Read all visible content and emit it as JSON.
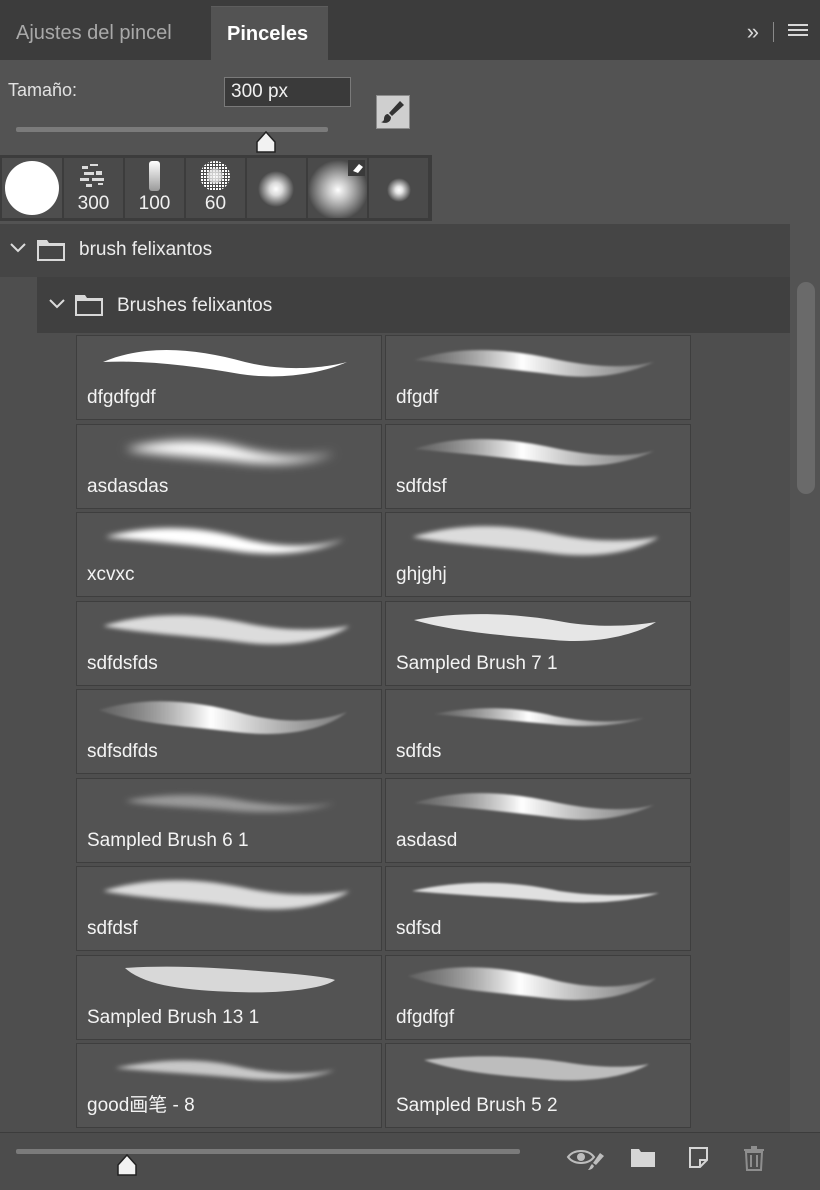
{
  "tabs": [
    {
      "label": "Ajustes del pincel",
      "active": false
    },
    {
      "label": "Pinceles",
      "active": true
    }
  ],
  "tab_controls": {
    "collapse_glyph": "»"
  },
  "size": {
    "label": "Tamaño:",
    "value": "300 px",
    "slider_fraction": 0.8
  },
  "presets": [
    {
      "icon": "hard-round-brush-icon",
      "number": ""
    },
    {
      "icon": "scatter-brush-icon",
      "number": "300"
    },
    {
      "icon": "chalk-brush-icon",
      "number": "100"
    },
    {
      "icon": "spatter-brush-icon",
      "number": "60"
    },
    {
      "icon": "soft-round-small-brush-icon",
      "number": ""
    },
    {
      "icon": "soft-round-large-brush-icon",
      "number": ""
    },
    {
      "icon": "soft-round-tiny-brush-icon",
      "number": ""
    }
  ],
  "group": {
    "name": "brush felixantos"
  },
  "subgroup": {
    "name": "Brushes felixantos"
  },
  "brushes": [
    {
      "name": "dfgdfgdf",
      "style": "hard"
    },
    {
      "name": "dfgdf",
      "style": "soft-gradient"
    },
    {
      "name": "asdasdas",
      "style": "airbrush"
    },
    {
      "name": "sdfdsf",
      "style": "soft-gradient"
    },
    {
      "name": "xcvxc",
      "style": "soft"
    },
    {
      "name": "ghjghj",
      "style": "textured"
    },
    {
      "name": "sdfdsfds",
      "style": "textured"
    },
    {
      "name": "Sampled Brush 7 1",
      "style": "rough"
    },
    {
      "name": "sdfsdfds",
      "style": "gradient-wide"
    },
    {
      "name": "sdfds",
      "style": "thin"
    },
    {
      "name": "Sampled Brush 6 1",
      "style": "faint"
    },
    {
      "name": "asdasd",
      "style": "soft-gradient"
    },
    {
      "name": "sdfdsf",
      "style": "textured"
    },
    {
      "name": "sdfsd",
      "style": "thin-textured"
    },
    {
      "name": "Sampled Brush 13 1",
      "style": "splatter"
    },
    {
      "name": "dfgdfgf",
      "style": "gradient-wide"
    },
    {
      "name": "good画笔 - 8",
      "style": "thin-soft"
    },
    {
      "name": "Sampled Brush 5 2",
      "style": "bristle"
    }
  ],
  "bottom": {
    "slider_fraction": 0.22
  }
}
